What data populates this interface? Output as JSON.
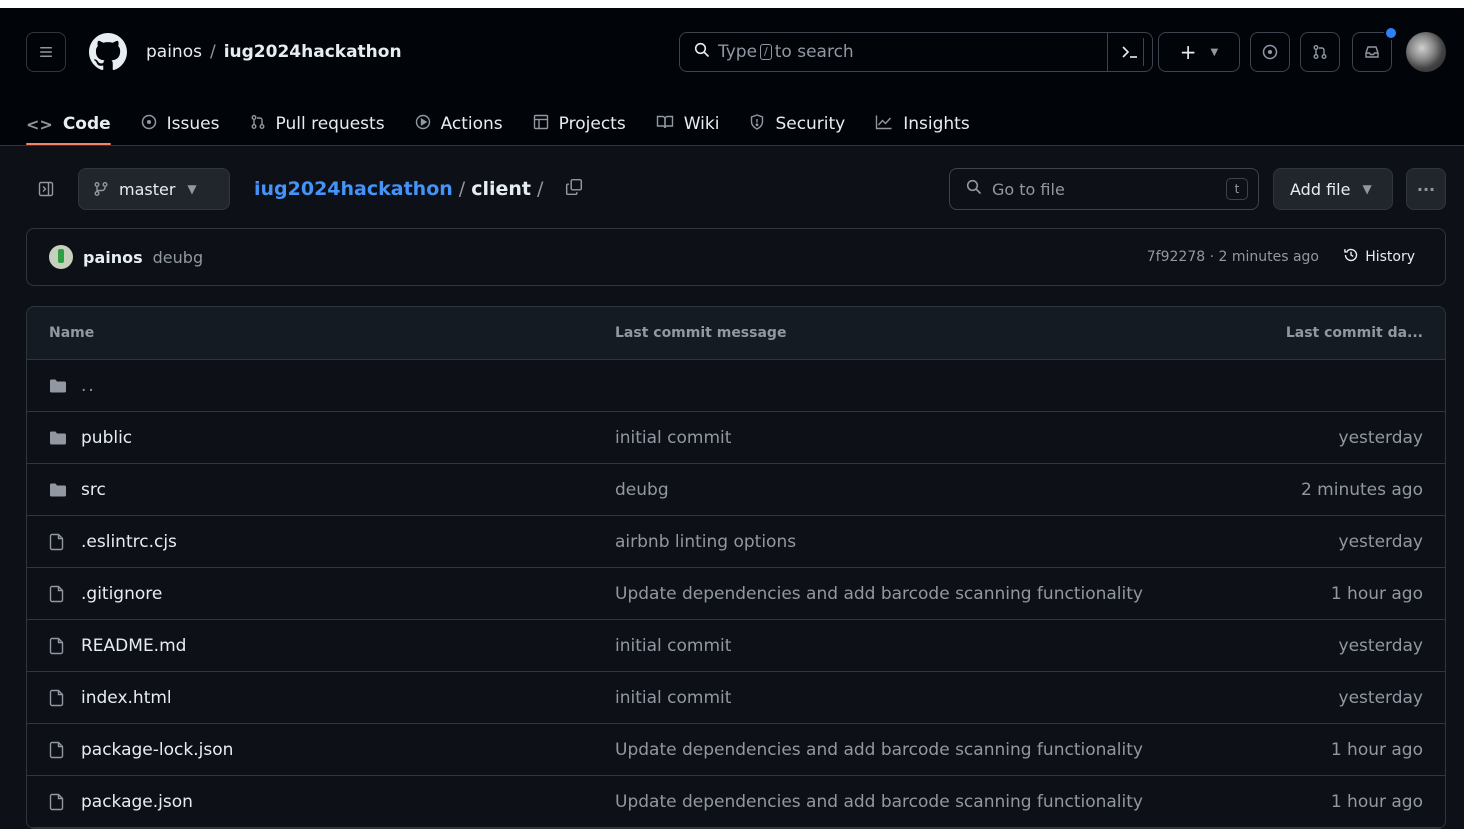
{
  "header": {
    "owner": "painos",
    "separator": "/",
    "repo": "iug2024hackathon",
    "search_placeholder_pre": "Type",
    "search_placeholder_key": "/",
    "search_placeholder_post": "to search",
    "plus": "+",
    "accent": "#2f81f7"
  },
  "nav": {
    "tabs": [
      {
        "label": "Code",
        "icon": "code-icon"
      },
      {
        "label": "Issues",
        "icon": "issue-icon"
      },
      {
        "label": "Pull requests",
        "icon": "pull-request-icon"
      },
      {
        "label": "Actions",
        "icon": "play-icon"
      },
      {
        "label": "Projects",
        "icon": "table-icon"
      },
      {
        "label": "Wiki",
        "icon": "book-icon"
      },
      {
        "label": "Security",
        "icon": "shield-icon"
      },
      {
        "label": "Insights",
        "icon": "graph-icon"
      }
    ]
  },
  "path": {
    "branch": "master",
    "repo_link": "iug2024hackathon",
    "sep": "/",
    "current": "client",
    "trailing_sep": "/"
  },
  "goto": {
    "placeholder": "Go to file",
    "shortcut": "t"
  },
  "add_file": "Add file",
  "commit": {
    "author": "painos",
    "message": "deubg",
    "meta": "7f92278 · 2 minutes ago",
    "history": "History"
  },
  "table": {
    "headers": [
      "Name",
      "Last commit message",
      "Last commit da..."
    ],
    "parent": "..",
    "rows": [
      {
        "type": "folder",
        "name": "public",
        "message": "initial commit",
        "date": "yesterday"
      },
      {
        "type": "folder",
        "name": "src",
        "message": "deubg",
        "date": "2 minutes ago"
      },
      {
        "type": "file",
        "name": ".eslintrc.cjs",
        "message": "airbnb linting options",
        "date": "yesterday"
      },
      {
        "type": "file",
        "name": ".gitignore",
        "message": "Update dependencies and add barcode scanning functionality",
        "date": "1 hour ago"
      },
      {
        "type": "file",
        "name": "README.md",
        "message": "initial commit",
        "date": "yesterday"
      },
      {
        "type": "file",
        "name": "index.html",
        "message": "initial commit",
        "date": "yesterday"
      },
      {
        "type": "file",
        "name": "package-lock.json",
        "message": "Update dependencies and add barcode scanning functionality",
        "date": "1 hour ago"
      },
      {
        "type": "file",
        "name": "package.json",
        "message": "Update dependencies and add barcode scanning functionality",
        "date": "1 hour ago"
      }
    ]
  }
}
